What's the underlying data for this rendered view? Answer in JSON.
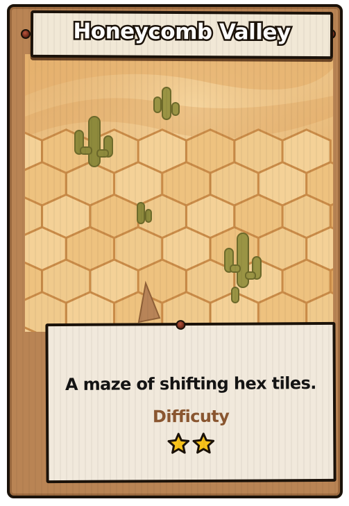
{
  "level_card": {
    "title": "Honeycomb Valley",
    "description": "A maze of shifting hex tiles.",
    "difficulty_label": "Difficuty",
    "difficulty_rating": 2,
    "difficulty_max": 2,
    "scene_icon": "desert-hex-landscape",
    "star_icon": "star-icon",
    "colors": {
      "frame": "#b98454",
      "panel": "#f1e9dc",
      "title_fill": "#ffffff",
      "outline": "#1b1209",
      "difficulty_text": "#8a5630",
      "star_fill": "#f7c21a"
    }
  }
}
